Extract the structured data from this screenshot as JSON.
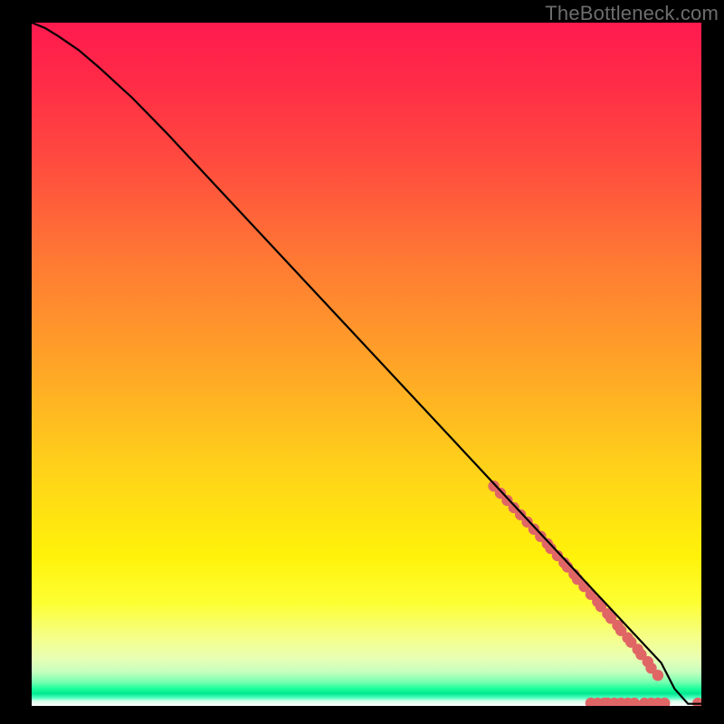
{
  "watermark": "TheBottleneck.com",
  "chart_data": {
    "type": "line",
    "title": "",
    "xlabel": "",
    "ylabel": "",
    "xlim": [
      0,
      100
    ],
    "ylim": [
      0,
      100
    ],
    "grid": false,
    "series": [
      {
        "name": "curve",
        "x": [
          0,
          2,
          4,
          7,
          10,
          15,
          20,
          30,
          40,
          50,
          60,
          70,
          80,
          84,
          86,
          88,
          90,
          92,
          94,
          96,
          98,
          100
        ],
        "y": [
          100,
          99.2,
          98.0,
          96.0,
          93.5,
          89.0,
          84.0,
          73.5,
          63.0,
          52.5,
          42.0,
          31.5,
          21.0,
          16.8,
          14.7,
          12.6,
          10.5,
          8.4,
          6.3,
          2.5,
          0.3,
          0.3
        ]
      }
    ],
    "dot_clusters": [
      {
        "cx": 72.5,
        "cy": 28.5,
        "count": 8,
        "axis": "diagonal"
      },
      {
        "cx": 76.0,
        "cy": 24.8,
        "count": 3,
        "axis": "diagonal"
      },
      {
        "cx": 78.5,
        "cy": 22.0,
        "count": 3,
        "axis": "diagonal"
      },
      {
        "cx": 80.5,
        "cy": 19.8,
        "count": 2,
        "axis": "diagonal"
      },
      {
        "cx": 82.0,
        "cy": 18.0,
        "count": 2,
        "axis": "diagonal"
      },
      {
        "cx": 84.0,
        "cy": 15.8,
        "count": 2,
        "axis": "diagonal"
      },
      {
        "cx": 85.5,
        "cy": 14.0,
        "count": 2,
        "axis": "diagonal"
      },
      {
        "cx": 87.0,
        "cy": 12.3,
        "count": 2,
        "axis": "diagonal"
      },
      {
        "cx": 88.5,
        "cy": 10.5,
        "count": 2,
        "axis": "diagonal"
      },
      {
        "cx": 90.0,
        "cy": 8.8,
        "count": 2,
        "axis": "diagonal"
      },
      {
        "cx": 91.5,
        "cy": 7.0,
        "count": 2,
        "axis": "diagonal"
      },
      {
        "cx": 93.0,
        "cy": 5.0,
        "count": 2,
        "axis": "diagonal"
      },
      {
        "cx": 84.5,
        "cy": 0.4,
        "count": 3,
        "axis": "horizontal"
      },
      {
        "cx": 87.0,
        "cy": 0.4,
        "count": 3,
        "axis": "horizontal"
      },
      {
        "cx": 89.5,
        "cy": 0.4,
        "count": 2,
        "axis": "horizontal"
      },
      {
        "cx": 92.0,
        "cy": 0.4,
        "count": 2,
        "axis": "horizontal"
      },
      {
        "cx": 94.0,
        "cy": 0.4,
        "count": 2,
        "axis": "horizontal"
      },
      {
        "cx": 99.5,
        "cy": 0.4,
        "count": 1,
        "axis": "horizontal"
      }
    ],
    "dot_color": "#e06666",
    "line_color": "#000000"
  }
}
